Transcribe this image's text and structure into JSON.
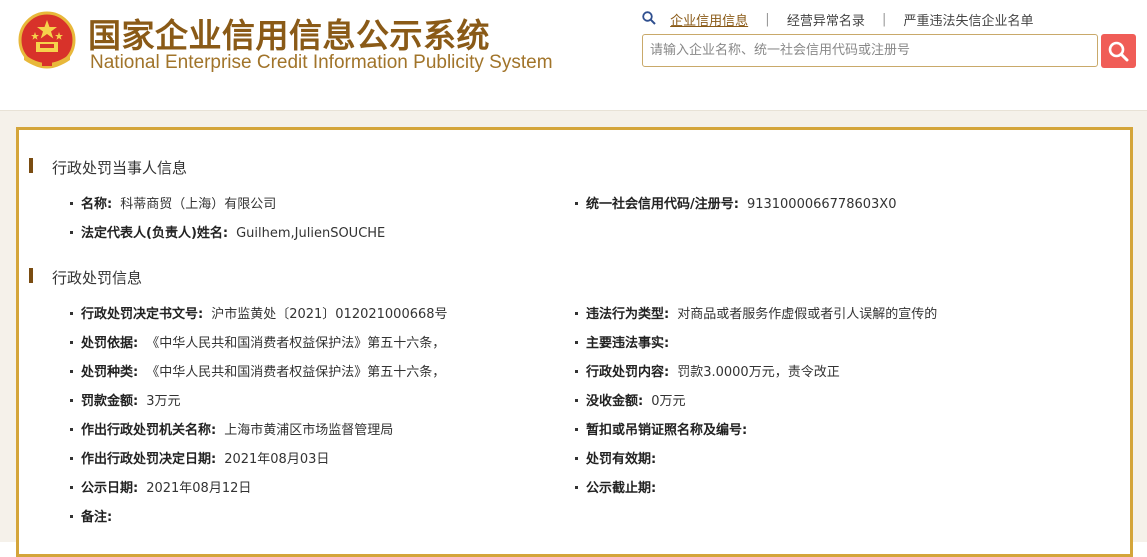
{
  "header": {
    "title_cn": "国家企业信用信息公示系统",
    "title_en": "National Enterprise Credit Information Publicity System",
    "links": [
      "企业信用信息",
      "经营异常名录",
      "严重违法失信企业名单"
    ],
    "search_placeholder": "请输入企业名称、统一社会信用代码或注册号"
  },
  "party_section": {
    "title": "行政处罚当事人信息",
    "name_label": "名称:",
    "name_value": "科蒂商贸（上海）有限公司",
    "credit_label": "统一社会信用代码/注册号:",
    "credit_value": "9131000066778603X0",
    "rep_label": "法定代表人(负责人)姓名:",
    "rep_value": "Guilhem,JulienSOUCHE"
  },
  "penalty_section": {
    "title": "行政处罚信息",
    "rows": [
      {
        "left_label": "行政处罚决定书文号:",
        "left_value": "沪市监黄处〔2021〕012021000668号",
        "right_label": "违法行为类型:",
        "right_value": "对商品或者服务作虚假或者引人误解的宣传的"
      },
      {
        "left_label": "处罚依据:",
        "left_value": "《中华人民共和国消费者权益保护法》第五十六条，",
        "right_label": "主要违法事实:",
        "right_value": ""
      },
      {
        "left_label": "处罚种类:",
        "left_value": "《中华人民共和国消费者权益保护法》第五十六条，",
        "right_label": "行政处罚内容:",
        "right_value": "罚款3.0000万元，责令改正"
      },
      {
        "left_label": "罚款金额:",
        "left_value": "3万元",
        "right_label": "没收金额:",
        "right_value": "0万元"
      },
      {
        "left_label": "作出行政处罚机关名称:",
        "left_value": "上海市黄浦区市场监督管理局",
        "right_label": "暂扣或吊销证照名称及编号:",
        "right_value": ""
      },
      {
        "left_label": "作出行政处罚决定日期:",
        "left_value": "2021年08月03日",
        "right_label": "处罚有效期:",
        "right_value": ""
      },
      {
        "left_label": "公示日期:",
        "left_value": "2021年08月12日",
        "right_label": "公示截止期:",
        "right_value": ""
      },
      {
        "left_label": "备注:",
        "left_value": "",
        "right_label": "",
        "right_value": ""
      }
    ]
  },
  "colors": {
    "brand_gold": "#8a5a17",
    "card_border": "#d4a53a",
    "search_button": "#f05d57"
  }
}
